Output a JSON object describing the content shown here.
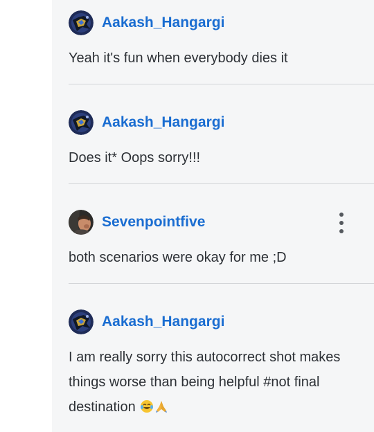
{
  "comments": [
    {
      "author": "Aakash_Hangargi",
      "avatar_icon": "superhero-avatar-icon",
      "text": "Yeah it's fun when everybody dies it"
    },
    {
      "author": "Aakash_Hangargi",
      "avatar_icon": "superhero-avatar-icon",
      "text": "Does it* Oops sorry!!!"
    },
    {
      "author": "Sevenpointfive",
      "avatar_icon": "profile-photo-avatar-icon",
      "text": "both scenarios were okay for me ;D",
      "menu_icon": "more-vertical-icon"
    },
    {
      "author": "Aakash_Hangargi",
      "avatar_icon": "superhero-avatar-icon",
      "text": "I am really sorry this autocorrect shot makes things worse than being helpful #not final destination",
      "emojis": [
        "tears-of-joy-emoji",
        "folded-hands-emoji"
      ]
    }
  ],
  "colors": {
    "username": "#1a6dd1",
    "text": "#2d3136",
    "divider": "#d3d5d8",
    "feed_background": "#f5f6f7"
  }
}
